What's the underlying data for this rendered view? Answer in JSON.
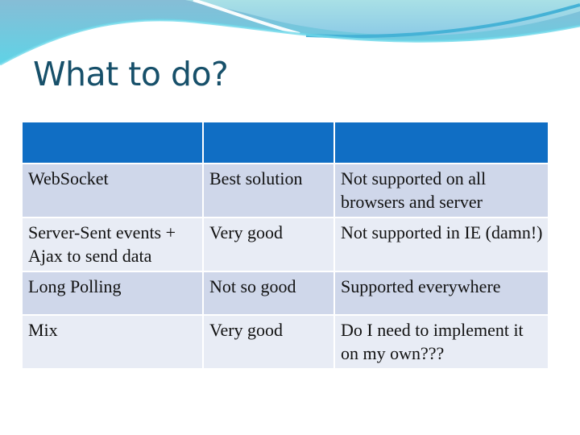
{
  "slide": {
    "title": "What to do?",
    "colors": {
      "title": "#17506a",
      "header_fill": "#106ec4",
      "row_dark": "#cfd7ea",
      "row_light": "#e8ecf5",
      "wave_light": "#a8dde6",
      "wave_mid": "#7fc3dc",
      "wave_accent": "#3fb3d8"
    }
  },
  "table": {
    "headers": [
      "",
      "",
      ""
    ],
    "rows": [
      [
        "WebSocket",
        "Best solution",
        "Not supported on all browsers and server"
      ],
      [
        "Server-Sent events + Ajax to send data",
        "Very good",
        "Not supported in IE (damn!)"
      ],
      [
        "Long Polling",
        "Not so good",
        "Supported everywhere"
      ],
      [
        "Mix",
        "Very good",
        "Do I need to implement it on my own???"
      ]
    ]
  }
}
